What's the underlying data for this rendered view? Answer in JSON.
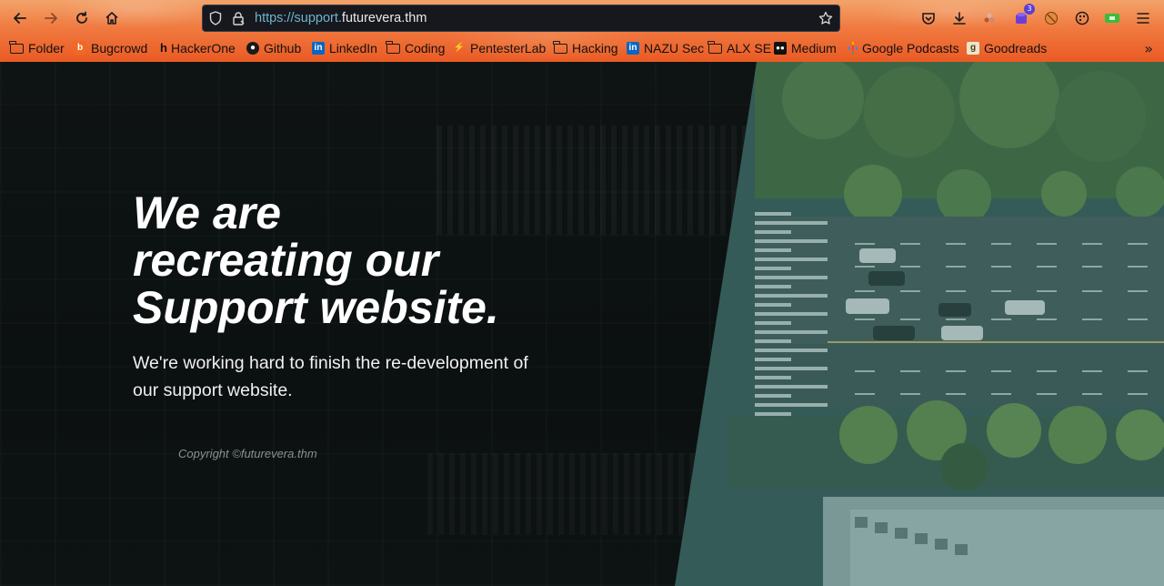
{
  "browser": {
    "url_prefix": "https://support.",
    "url_domain": "futurevera.thm",
    "bookmarks": [
      {
        "label": "Folder",
        "icon": "folder-icon"
      },
      {
        "label": "Bugcrowd",
        "icon": "bugcrowd-icon",
        "color": "#f26822"
      },
      {
        "label": "HackerOne",
        "icon": "hackerone-icon"
      },
      {
        "label": "Github",
        "icon": "github-icon"
      },
      {
        "label": "LinkedIn",
        "icon": "linkedin-icon",
        "color": "#0a66c2"
      },
      {
        "label": "Coding",
        "icon": "folder-icon"
      },
      {
        "label": "PentesterLab",
        "icon": "pentesterlab-icon"
      },
      {
        "label": "Hacking",
        "icon": "folder-icon"
      },
      {
        "label": "NAZU Sec",
        "icon": "linkedin-icon",
        "color": "#0a66c2"
      },
      {
        "label": "ALX SE",
        "icon": "folder-icon"
      },
      {
        "label": "Medium",
        "icon": "medium-icon"
      },
      {
        "label": "Google Podcasts",
        "icon": "google-podcasts-icon"
      },
      {
        "label": "Goodreads",
        "icon": "goodreads-icon"
      }
    ],
    "extension_badge": "3",
    "accent": "#ea5a24"
  },
  "page": {
    "headline_line1": "We are",
    "headline_line2": "recreating our",
    "headline_line3": "Support website.",
    "subtext": "We're working hard to finish the re-development of our support website.",
    "copyright": "Copyright ©futurevera.thm"
  }
}
